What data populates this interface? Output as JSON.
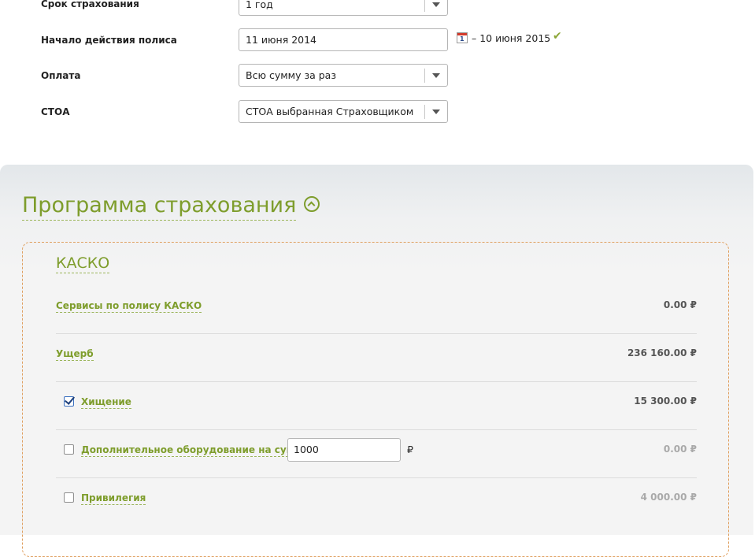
{
  "form": {
    "term": {
      "label": "Срок страхования",
      "value": "1 год"
    },
    "start": {
      "label": "Начало действия полиса",
      "value": "11 июня 2014",
      "calendar_day": "1",
      "end_text": "– 10 июня 2015",
      "check_icon": "check-icon"
    },
    "payment": {
      "label": "Оплата",
      "value": "Всю сумму за раз"
    },
    "stoa": {
      "label": "СТОА",
      "value": "СТОА выбранная Страховщиком"
    }
  },
  "program": {
    "title": "Программа страхования",
    "toggle_icon": "collapse-up-icon",
    "kasko": {
      "title": "КАСКО",
      "rows": [
        {
          "label": "Сервисы по полису КАСКО",
          "price": "0.00 ₽"
        },
        {
          "label": "Ущерб",
          "price": "236 160.00 ₽"
        },
        {
          "label": "Хищение",
          "price": "15 300.00 ₽",
          "checked": true
        },
        {
          "label": "Дополнительное оборудование на сумму",
          "input_value": "1000",
          "currency": "₽",
          "price": "0.00 ₽",
          "checked": false
        },
        {
          "label": "Привилегия",
          "price": "4 000.00 ₽",
          "checked": false
        }
      ]
    }
  },
  "colors": {
    "accent_green": "#7e9d2c",
    "dashed_orange": "#e0a060",
    "muted_price": "#a9a9a9"
  }
}
